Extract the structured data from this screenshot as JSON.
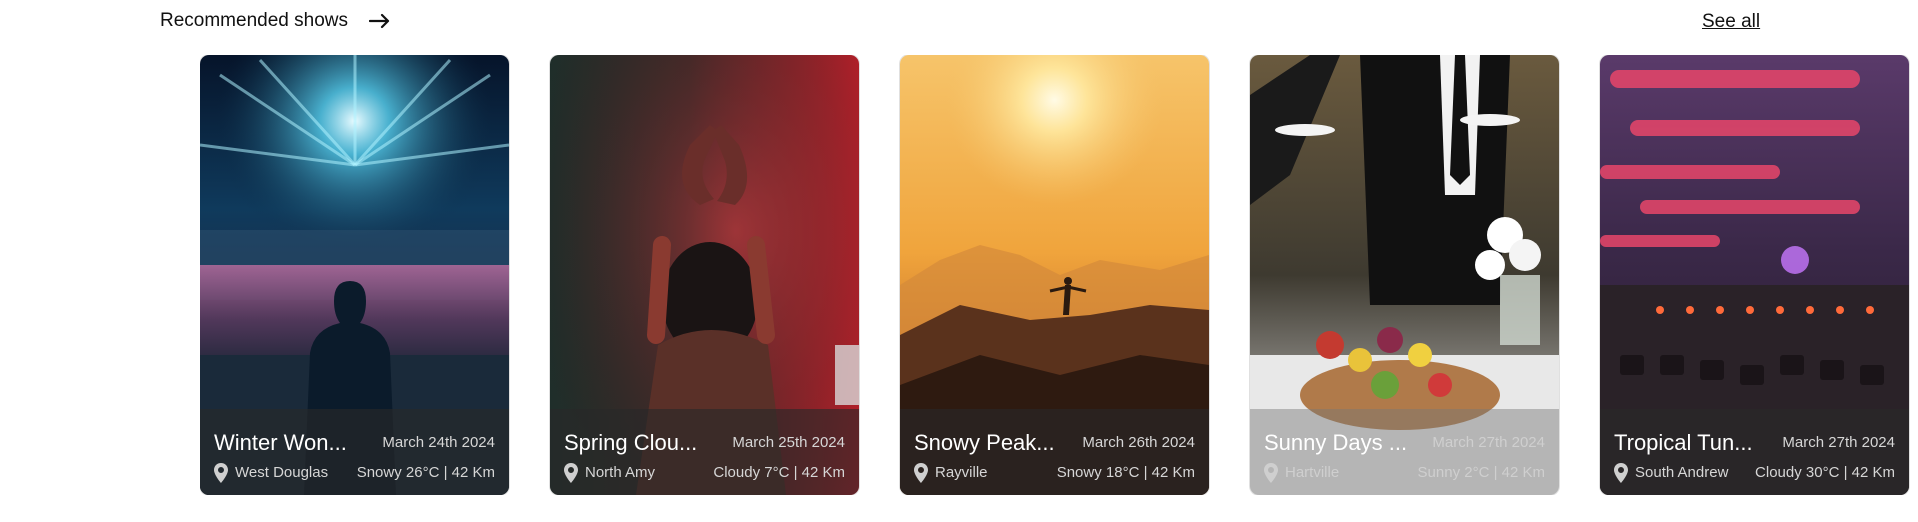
{
  "section": {
    "title": "Recommended shows",
    "see_all_label": "See all"
  },
  "cards": [
    {
      "title": "Winter Won...",
      "date": "March 24th 2024",
      "location": "West Douglas",
      "weather": "Snowy 26°C | 42 Km",
      "image_icon": "concert-stage-image"
    },
    {
      "title": "Spring Clou...",
      "date": "March 25th 2024",
      "location": "North Amy",
      "weather": "Cloudy 7°C | 42 Km",
      "image_icon": "dj-performer-image"
    },
    {
      "title": "Snowy Peak...",
      "date": "March 26th 2024",
      "location": "Rayville",
      "weather": "Snowy 18°C | 42 Km",
      "image_icon": "mountain-sunset-image"
    },
    {
      "title": "Sunny Days ...",
      "date": "March 27th 2024",
      "location": "Hartville",
      "weather": "Sunny 2°C | 42 Km",
      "image_icon": "catering-buffet-image"
    },
    {
      "title": "Tropical Tun...",
      "date": "March 27th 2024",
      "location": "South Andrew",
      "weather": "Cloudy 30°C | 42 Km",
      "image_icon": "mixing-console-image"
    }
  ]
}
